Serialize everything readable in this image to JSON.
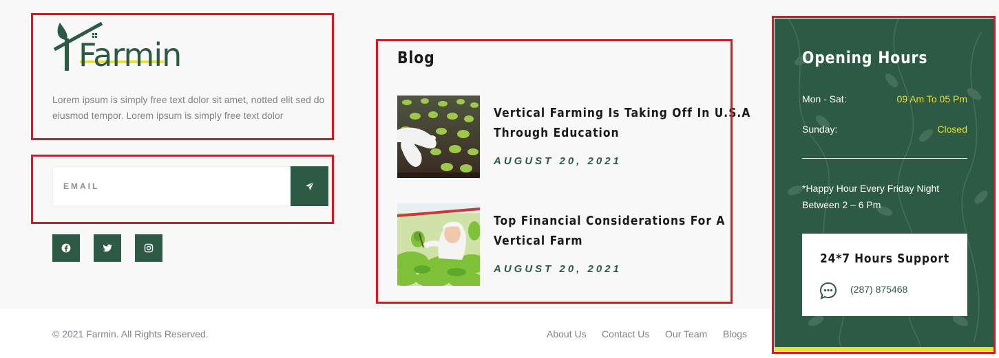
{
  "brand": {
    "logo_text": "Farmin",
    "about": "Lorem ipsum is simply free text dolor sit amet, notted elit sed do eiusmod tempor. Lorem ipsum is simply free text dolor"
  },
  "newsletter": {
    "placeholder": "EMAIL"
  },
  "social": [
    "facebook-icon",
    "twitter-icon",
    "instagram-icon"
  ],
  "blog": {
    "title": "Blog",
    "posts": [
      {
        "title_line1": "Vertical Farming Is Taking Off In U.S.A",
        "title_line2": "Through Education",
        "date": "AUGUST 20, 2021"
      },
      {
        "title_line1": "Top Financial Considerations For A",
        "title_line2": "Vertical Farm",
        "date": "AUGUST 20, 2021"
      }
    ]
  },
  "hours": {
    "title": "Opening Hours",
    "rows": [
      {
        "label": "Mon - Sat:",
        "value": "09 Am To 05 Pm"
      },
      {
        "label": "Sunday:",
        "value": "Closed"
      }
    ],
    "happy_hour_line1": "*Happy Hour Every Friday Night",
    "happy_hour_line2": "Between 2 – 6 Pm",
    "support_title": "24*7 Hours Support",
    "support_phone": "(287) 875468"
  },
  "bottom": {
    "copyright": "© 2021 Farmin. All Rights Reserved.",
    "links": [
      "About Us",
      "Contact Us",
      "Our Team",
      "Blogs"
    ]
  },
  "colors": {
    "brand_green": "#2c5a45",
    "accent_yellow": "#e8e03a",
    "highlight_red": "#e8121c"
  }
}
